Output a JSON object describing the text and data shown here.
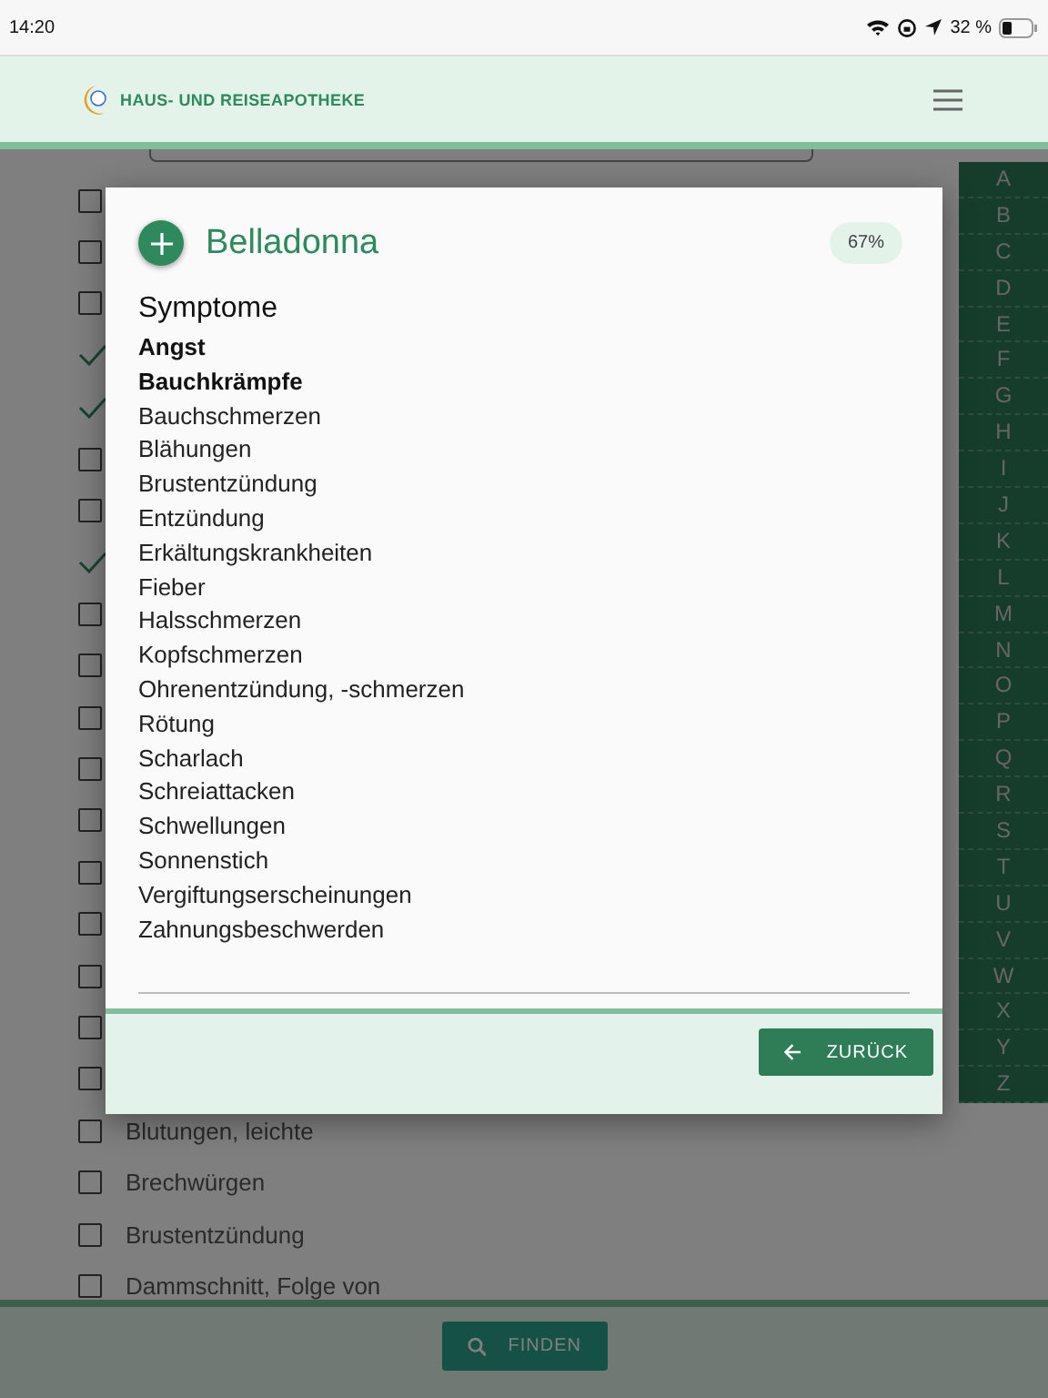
{
  "status_bar": {
    "time": "14:20",
    "battery": "32 %"
  },
  "header": {
    "title": "HAUS- UND REISEAPOTHEKE"
  },
  "symptom_list": [
    {
      "checked": false
    },
    {
      "checked": false
    },
    {
      "checked": false
    },
    {
      "checked": true
    },
    {
      "checked": true
    },
    {
      "checked": false
    },
    {
      "checked": false
    },
    {
      "checked": true
    },
    {
      "checked": false
    },
    {
      "checked": false
    },
    {
      "checked": false
    },
    {
      "checked": false
    },
    {
      "checked": false
    },
    {
      "checked": false
    },
    {
      "checked": false
    },
    {
      "checked": false
    },
    {
      "checked": false
    },
    {
      "checked": false
    },
    {
      "checked": false,
      "label": "Blutungen, leichte"
    },
    {
      "checked": false,
      "label": "Brechwürgen"
    },
    {
      "checked": false,
      "label": "Brustentzündung"
    },
    {
      "checked": false,
      "label": "Dammschnitt, Folge von"
    }
  ],
  "alphabet": [
    "A",
    "B",
    "C",
    "D",
    "E",
    "F",
    "G",
    "H",
    "I",
    "J",
    "K",
    "L",
    "M",
    "N",
    "O",
    "P",
    "Q",
    "R",
    "S",
    "T",
    "U",
    "V",
    "W",
    "X",
    "Y",
    "Z"
  ],
  "footer": {
    "button": "FINDEN"
  },
  "dialog": {
    "title": "Belladonna",
    "match": "67%",
    "section": "Symptome",
    "symptoms": [
      {
        "label": "Angst",
        "matched": true
      },
      {
        "label": "Bauchkrämpfe",
        "matched": true
      },
      {
        "label": "Bauchschmerzen",
        "matched": false
      },
      {
        "label": "Blähungen",
        "matched": false
      },
      {
        "label": "Brustentzündung",
        "matched": false
      },
      {
        "label": "Entzündung",
        "matched": false
      },
      {
        "label": "Erkältungskrankheiten",
        "matched": false
      },
      {
        "label": "Fieber",
        "matched": false
      },
      {
        "label": "Halsschmerzen",
        "matched": false
      },
      {
        "label": "Kopfschmerzen",
        "matched": false
      },
      {
        "label": "Ohrenentzündung, -schmerzen",
        "matched": false
      },
      {
        "label": "Rötung",
        "matched": false
      },
      {
        "label": "Scharlach",
        "matched": false
      },
      {
        "label": "Schreiattacken",
        "matched": false
      },
      {
        "label": "Schwellungen",
        "matched": false
      },
      {
        "label": "Sonnenstich",
        "matched": false
      },
      {
        "label": "Vergiftungserscheinungen",
        "matched": false
      },
      {
        "label": "Zahnungsbeschwerden",
        "matched": false
      }
    ],
    "button": "ZURÜCK"
  }
}
